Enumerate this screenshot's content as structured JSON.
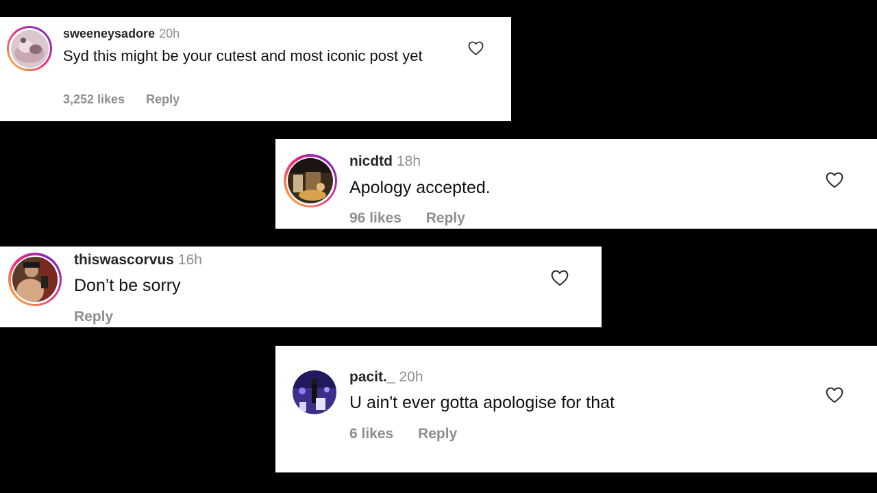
{
  "comments": [
    {
      "username": "sweeneysadore",
      "time": "20h",
      "text": "Syd this might be your cutest and most iconic post yet",
      "likes": "3,252 likes",
      "reply": "Reply"
    },
    {
      "username": "nicdtd",
      "time": "18h",
      "text": "Apology accepted.",
      "likes": "96 likes",
      "reply": "Reply"
    },
    {
      "username": "thiswascorvus",
      "time": "16h",
      "text": "Don’t be sorry",
      "likes": "",
      "reply": "Reply"
    },
    {
      "username": "pacit._",
      "time": "20h",
      "text": "U ain't ever gotta apologise for that",
      "likes": "6 likes",
      "reply": "Reply"
    }
  ],
  "icons": {
    "like": "heart-outline-icon",
    "avatar": "profile-photo"
  },
  "colors": {
    "background": "#000000",
    "card": "#ffffff",
    "username": "#262626",
    "muted": "#8e8e8e",
    "story_ring": [
      "#f9ce34",
      "#ee2a7b",
      "#6228d7"
    ]
  }
}
